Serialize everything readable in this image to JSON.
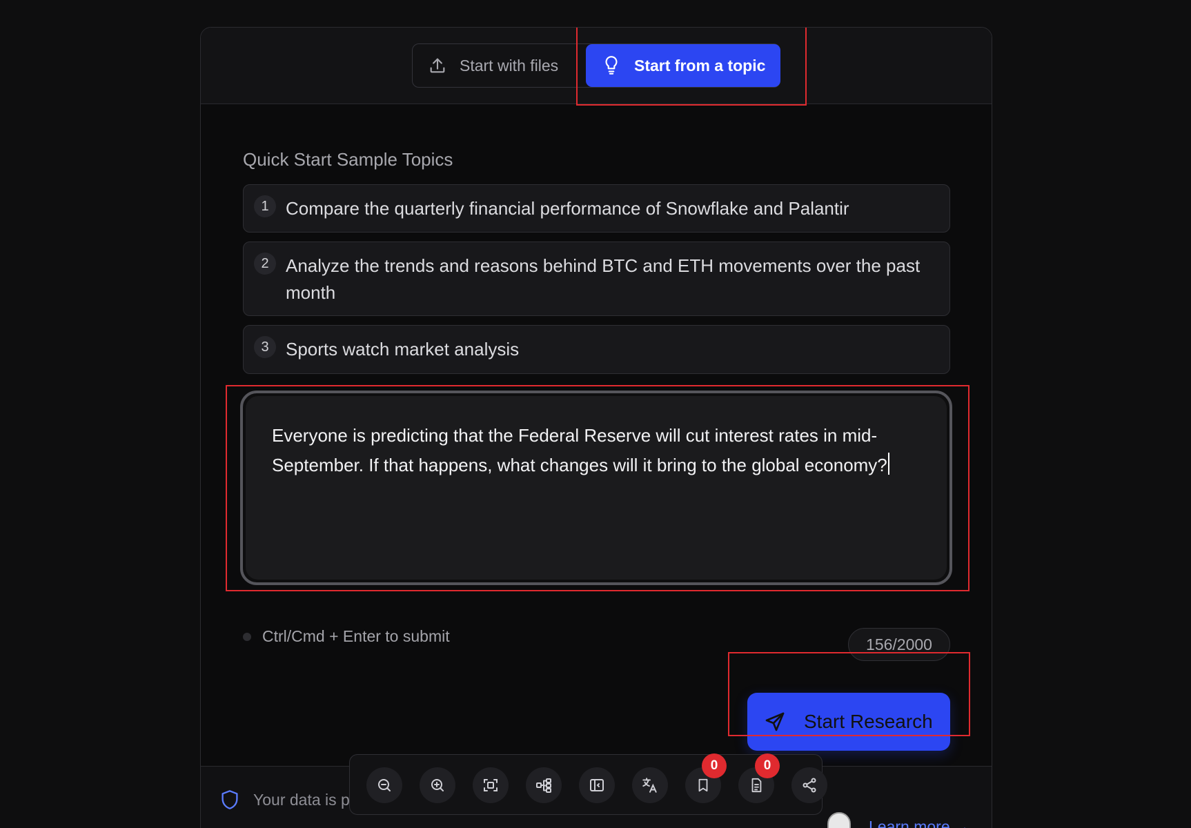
{
  "tabs": {
    "files": {
      "label": "Start with files",
      "icon": "upload-icon"
    },
    "topic": {
      "label": "Start from a topic",
      "icon": "lightbulb-icon",
      "active": true
    }
  },
  "quick_start": {
    "title": "Quick Start Sample Topics",
    "items": [
      {
        "number": "1",
        "text": "Compare the quarterly financial performance of Snowflake and Palantir"
      },
      {
        "number": "2",
        "text": "Analyze the trends and reasons behind BTC and ETH movements over the past month"
      },
      {
        "number": "3",
        "text": "Sports watch market analysis"
      }
    ]
  },
  "editor": {
    "value": "Everyone is predicting that the Federal Reserve will cut interest rates in mid-September. If that happens, what changes will it bring to the global economy?"
  },
  "hint": {
    "text": "Ctrl/Cmd + Enter to submit"
  },
  "counter": {
    "text": "156/2000"
  },
  "start_button": {
    "label": "Start Research",
    "icon": "send-icon"
  },
  "footer": {
    "privacy_text": "Your data is p",
    "learn_more": "Learn more →"
  },
  "toolbar": {
    "tools": [
      {
        "name": "zoom-out-icon"
      },
      {
        "name": "zoom-in-icon"
      },
      {
        "name": "fit-screen-icon"
      },
      {
        "name": "mind-map-icon"
      },
      {
        "name": "sidebar-collapse-icon"
      },
      {
        "name": "translate-icon"
      },
      {
        "name": "bookmark-icon",
        "badge": "0"
      },
      {
        "name": "notes-icon",
        "badge": "0"
      },
      {
        "name": "share-icon"
      }
    ]
  },
  "colors": {
    "accent": "#2c46f2",
    "highlight": "#e02a2f",
    "badge": "#e02a2f",
    "link": "#5b7cff"
  }
}
